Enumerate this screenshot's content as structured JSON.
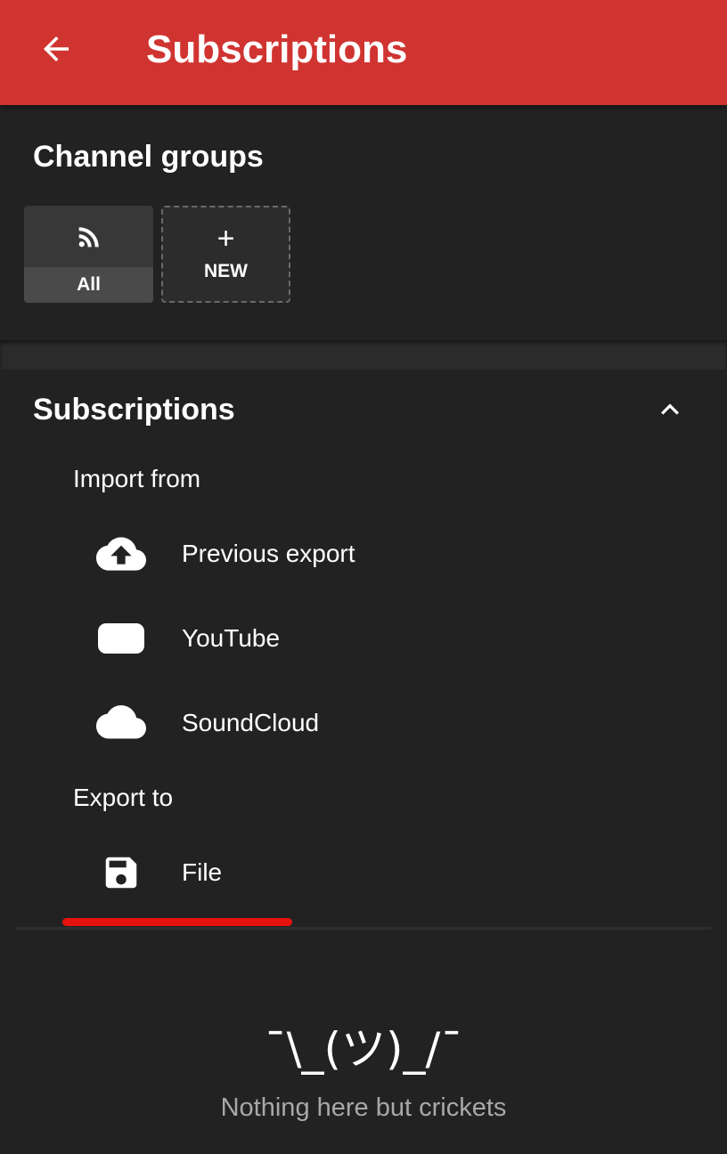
{
  "appbar": {
    "title": "Subscriptions",
    "back_icon": "arrow-back-icon",
    "color": "#d03431"
  },
  "channel_groups": {
    "title": "Channel groups",
    "groups": [
      {
        "label": "All",
        "icon": "rss-feed-icon"
      },
      {
        "label": "NEW",
        "icon": "plus-icon",
        "symbol": "+"
      }
    ]
  },
  "subscriptions": {
    "title": "Subscriptions",
    "collapse_icon": "chevron-up-icon",
    "import_label": "Import from",
    "import_items": [
      {
        "label": "Previous export",
        "icon": "cloud-upload-icon"
      },
      {
        "label": "YouTube",
        "icon": "youtube-icon"
      },
      {
        "label": "SoundCloud",
        "icon": "cloud-icon"
      }
    ],
    "export_label": "Export to",
    "export_items": [
      {
        "label": "File",
        "icon": "save-icon"
      }
    ]
  },
  "empty_state": {
    "emoticon": "¯\\_(ツ)_/¯",
    "message": "Nothing here but crickets"
  },
  "colors": {
    "background": "#222222",
    "accent": "#d03431",
    "annotation_underline": "#e5120d",
    "muted_text": "#a8a8a8"
  }
}
